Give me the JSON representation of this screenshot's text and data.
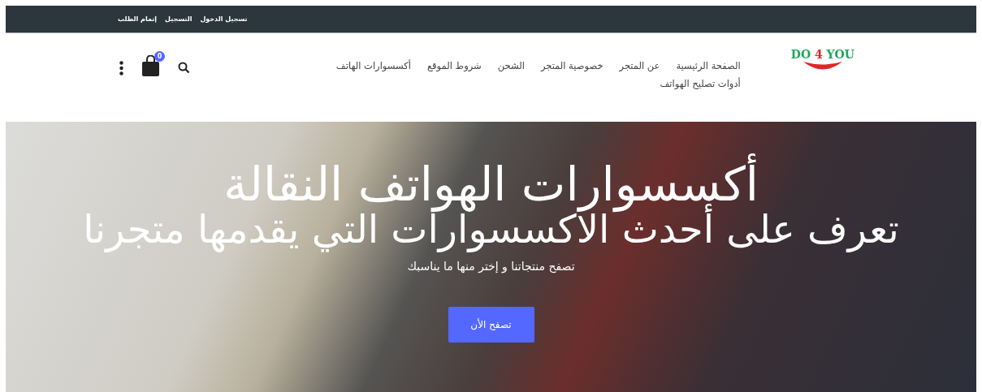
{
  "top_bar": {
    "links": [
      "تسجيل الدخول",
      "التسجيل",
      "إتمام الطلب"
    ]
  },
  "header": {
    "logo": {
      "text_left": "DO",
      "text_mid": "4",
      "text_right": "YOU"
    },
    "nav": [
      {
        "label": "الصفحة الرئيسية"
      },
      {
        "label": "عن المتجر"
      },
      {
        "label": "خصوصية المتجر"
      },
      {
        "label": "الشحن"
      },
      {
        "label": "شروط الموقع"
      },
      {
        "label": "أكسسوارات الهاتف"
      },
      {
        "label": "أدوات تصليح الهواتف"
      }
    ],
    "cart_count": "0"
  },
  "hero": {
    "title": "أكسسوارات الهواتف النقالة",
    "subtitle": "تعرف على أحدث الاكسسوارات التي يقدمها متجرنا",
    "text": "تصفح منتجاتنا و إختر منها ما يناسبك",
    "button": "تصفح الأن"
  }
}
